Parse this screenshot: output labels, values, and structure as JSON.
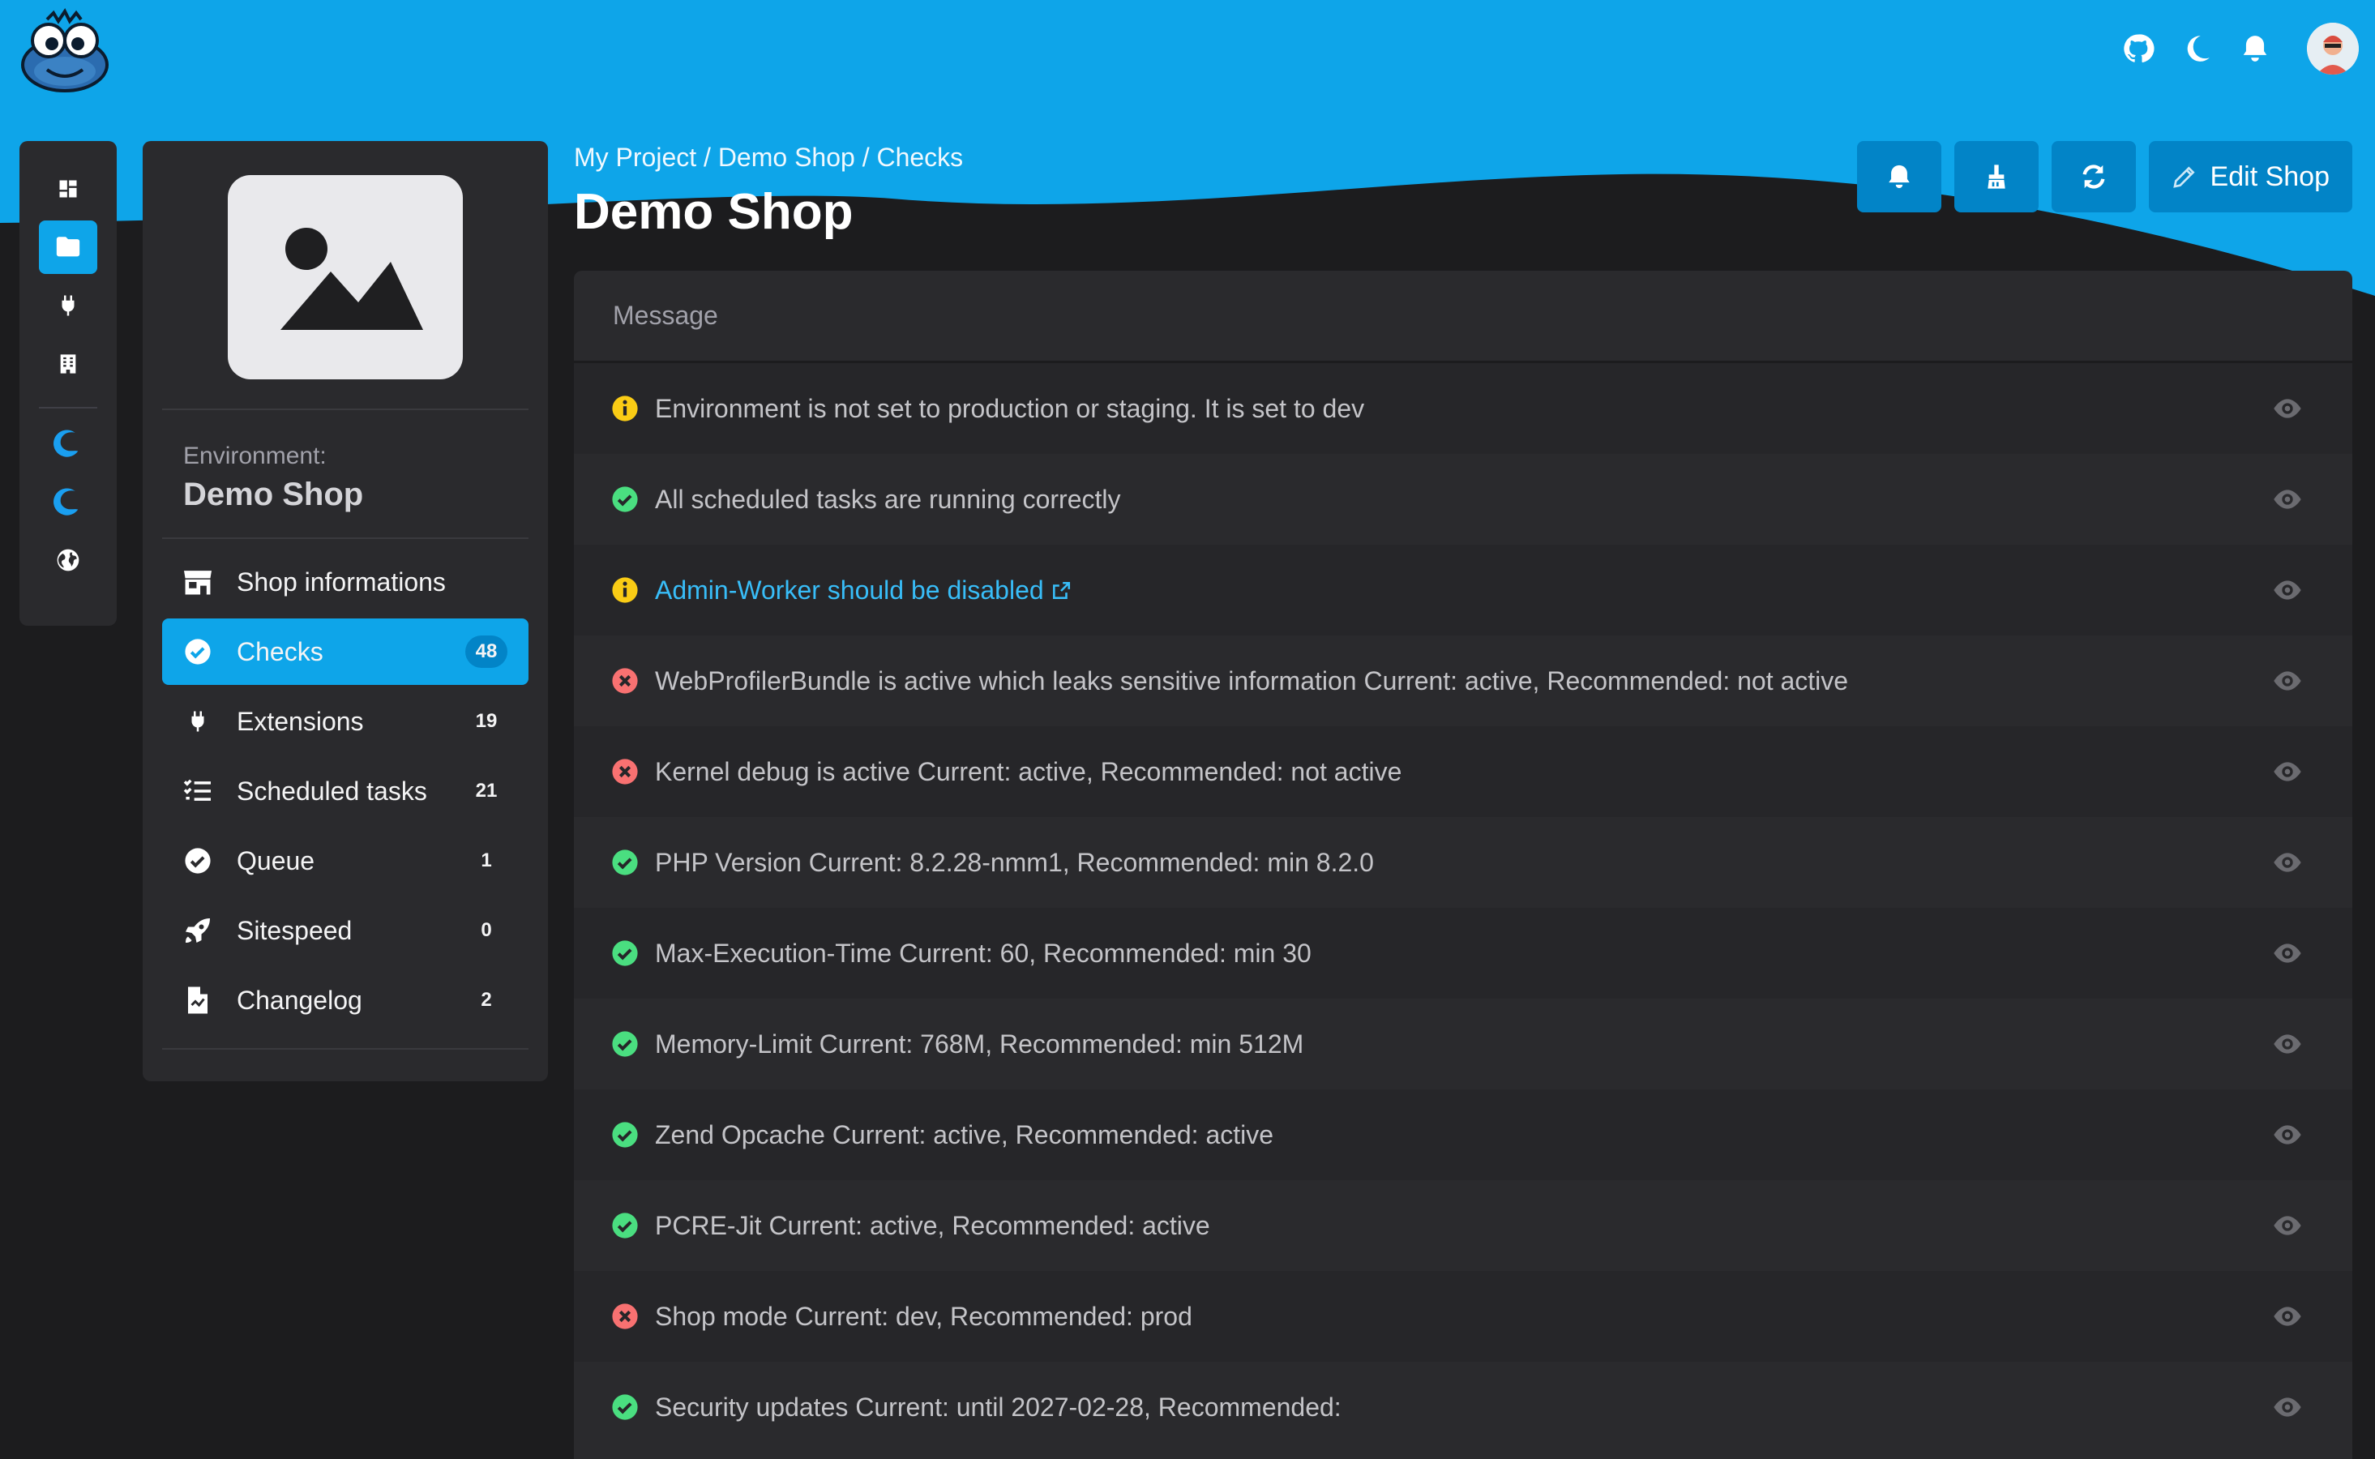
{
  "colors": {
    "brand_blue": "#0ea5e9",
    "button_blue": "#0284c7",
    "panel": "#2a2a2d",
    "background": "#1c1c1e",
    "status_info": "#facc15",
    "status_ok": "#4ade80",
    "status_error": "#f87171",
    "link": "#38bdf8"
  },
  "topbar": {
    "logo": "frog-mascot-logo",
    "icons": [
      "github-icon",
      "moon-icon",
      "bell-icon"
    ],
    "avatar": "user-avatar"
  },
  "rail": {
    "items": [
      {
        "icon": "dashboard-icon",
        "active": false
      },
      {
        "icon": "folder-icon",
        "active": true
      },
      {
        "icon": "plug-icon",
        "active": false
      },
      {
        "icon": "building-icon",
        "active": false
      },
      {
        "icon": "shopware-icon",
        "active": false
      },
      {
        "icon": "shopware-icon",
        "active": false
      },
      {
        "icon": "globe-icon",
        "active": false
      }
    ]
  },
  "panel": {
    "image": "image-placeholder-icon",
    "env_label": "Environment:",
    "env_name": "Demo Shop",
    "nav": [
      {
        "label": "Shop informations",
        "icon": "store-icon",
        "count": "",
        "active": false
      },
      {
        "label": "Checks",
        "icon": "check-circle-icon",
        "count": "48",
        "active": true
      },
      {
        "label": "Extensions",
        "icon": "plug-icon",
        "count": "19",
        "active": false
      },
      {
        "label": "Scheduled tasks",
        "icon": "list-check-icon",
        "count": "21",
        "active": false
      },
      {
        "label": "Queue",
        "icon": "check-circle-icon",
        "count": "1",
        "active": false
      },
      {
        "label": "Sitespeed",
        "icon": "rocket-icon",
        "count": "0",
        "active": false
      },
      {
        "label": "Changelog",
        "icon": "file-icon",
        "count": "2",
        "active": false
      }
    ]
  },
  "header": {
    "breadcrumb": [
      "My Project",
      "Demo Shop",
      "Checks"
    ],
    "separator": " / ",
    "title": "Demo Shop",
    "actions": [
      {
        "icon": "bell-icon",
        "label": ""
      },
      {
        "icon": "broom-icon",
        "label": ""
      },
      {
        "icon": "refresh-icon",
        "label": ""
      },
      {
        "icon": "pencil-icon",
        "label": "Edit Shop"
      }
    ]
  },
  "table": {
    "header": "Message",
    "rows": [
      {
        "status": "info",
        "text": "Environment is not set to production or staging. It is set to dev",
        "link": false
      },
      {
        "status": "ok",
        "text": "All scheduled tasks are running correctly",
        "link": false
      },
      {
        "status": "info",
        "text": "Admin-Worker should be disabled",
        "link": true
      },
      {
        "status": "error",
        "text": "WebProfilerBundle is active which leaks sensitive information Current: active, Recommended: not active",
        "link": false
      },
      {
        "status": "error",
        "text": "Kernel debug is active Current: active, Recommended: not active",
        "link": false
      },
      {
        "status": "ok",
        "text": "PHP Version Current: 8.2.28-nmm1, Recommended: min 8.2.0",
        "link": false
      },
      {
        "status": "ok",
        "text": "Max-Execution-Time Current: 60, Recommended: min 30",
        "link": false
      },
      {
        "status": "ok",
        "text": "Memory-Limit Current: 768M, Recommended: min 512M",
        "link": false
      },
      {
        "status": "ok",
        "text": "Zend Opcache Current: active, Recommended: active",
        "link": false
      },
      {
        "status": "ok",
        "text": "PCRE-Jit Current: active, Recommended: active",
        "link": false
      },
      {
        "status": "error",
        "text": "Shop mode Current: dev, Recommended: prod",
        "link": false
      },
      {
        "status": "ok",
        "text": "Security updates Current: until 2027-02-28, Recommended:",
        "link": false
      }
    ]
  }
}
